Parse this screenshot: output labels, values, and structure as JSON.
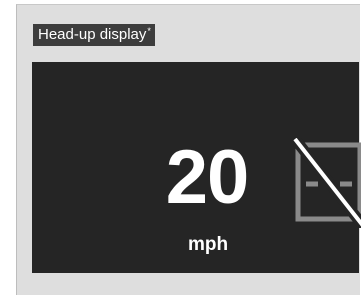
{
  "header": {
    "title": "Head-up display",
    "title_mark": "*"
  },
  "display": {
    "speed_value": "20",
    "speed_unit": "mph",
    "status_icon": "lane-keeping-off-icon",
    "colors": {
      "screen_background": "#252525",
      "speed_text": "#ffffff",
      "icon_stroke": "#8a8a8a",
      "icon_slash": "#ffffff"
    }
  }
}
